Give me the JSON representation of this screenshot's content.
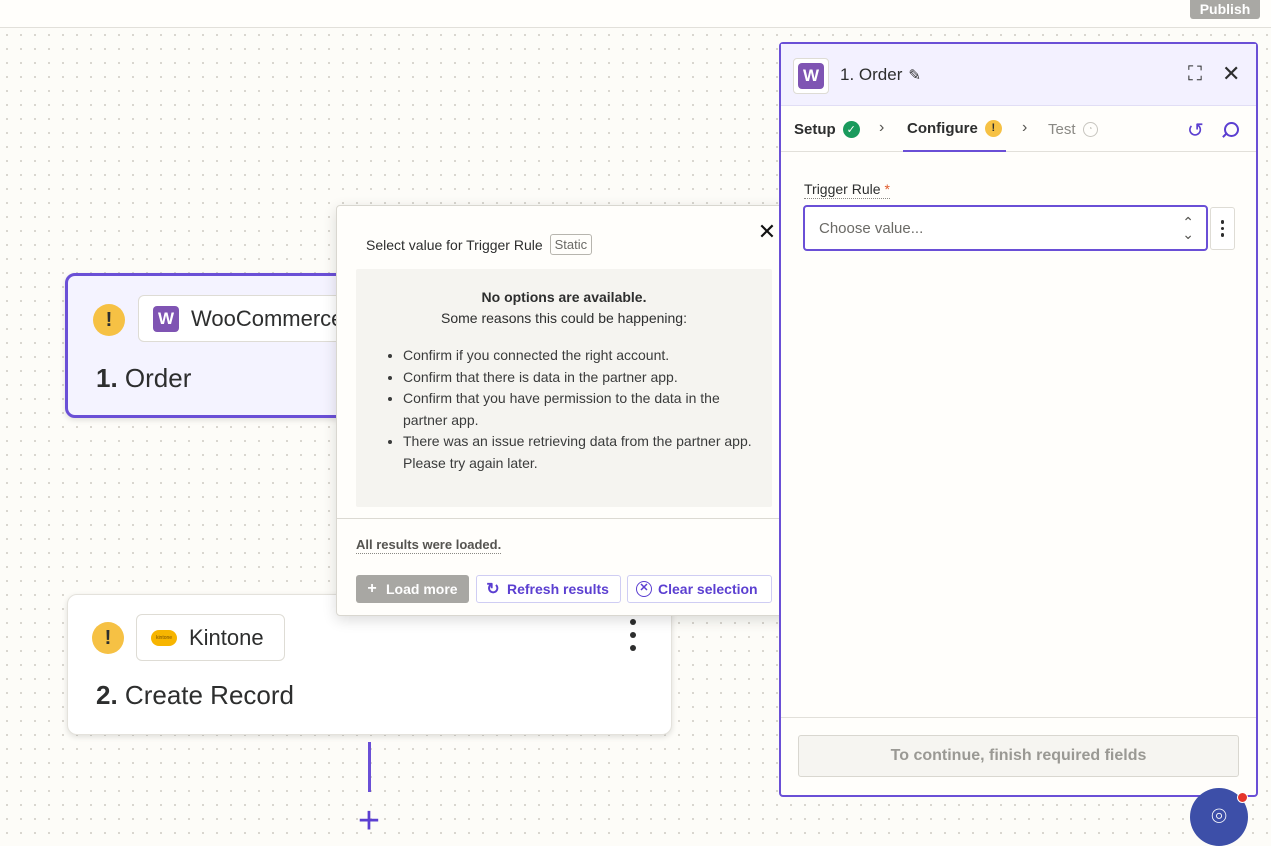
{
  "topbar": {
    "publish_label": "Publish"
  },
  "canvas": {
    "order_step": {
      "app_name": "WooCommerce",
      "step_number": "1.",
      "step_title": "Order",
      "app_logo_letter": "W"
    },
    "kintone_step": {
      "app_name": "Kintone",
      "step_number": "2.",
      "step_title": "Create Record",
      "app_logo_text": "kintone"
    },
    "warn_glyph": "!",
    "add_step_glyph": "+"
  },
  "popover": {
    "title": "Select value for Trigger Rule",
    "tag": "Static",
    "close_glyph": "✕",
    "empty_heading": "No options are available.",
    "empty_sub": "Some reasons this could be happening:",
    "reasons": [
      "Confirm if you connected the right account.",
      "Confirm that there is data in the partner app.",
      "Confirm that you have permission to the data in the partner app.",
      "There was an issue retrieving data from the partner app. Please try again later."
    ],
    "loaded_text": "All results were loaded.",
    "load_more_label": "Load more",
    "refresh_label": "Refresh results",
    "clear_label": "Clear selection"
  },
  "panel": {
    "logo_letter": "W",
    "title": "1. Order",
    "tabs": [
      {
        "label": "Setup",
        "status": "complete"
      },
      {
        "label": "Configure",
        "status": "warning"
      },
      {
        "label": "Test",
        "status": "pending"
      }
    ],
    "field_label": "Trigger Rule",
    "required_mark": "*",
    "select_placeholder": "Choose value...",
    "continue_label": "To continue, finish required fields"
  },
  "colors": {
    "accent": "#6a4fd6",
    "link": "#5b3fd1",
    "warning": "#f6c144",
    "success": "#1a9a5c",
    "woocommerce": "#7f54b3",
    "help_button": "#3d4fa8"
  },
  "icons": [
    "pencil-icon",
    "expand-icon",
    "close-icon",
    "chevron-right-icon",
    "check-circle-icon",
    "warning-icon",
    "timer-icon",
    "refresh-icon",
    "search-icon",
    "updown-icon",
    "kebab-menu-icon",
    "plus-icon",
    "help-icon"
  ]
}
